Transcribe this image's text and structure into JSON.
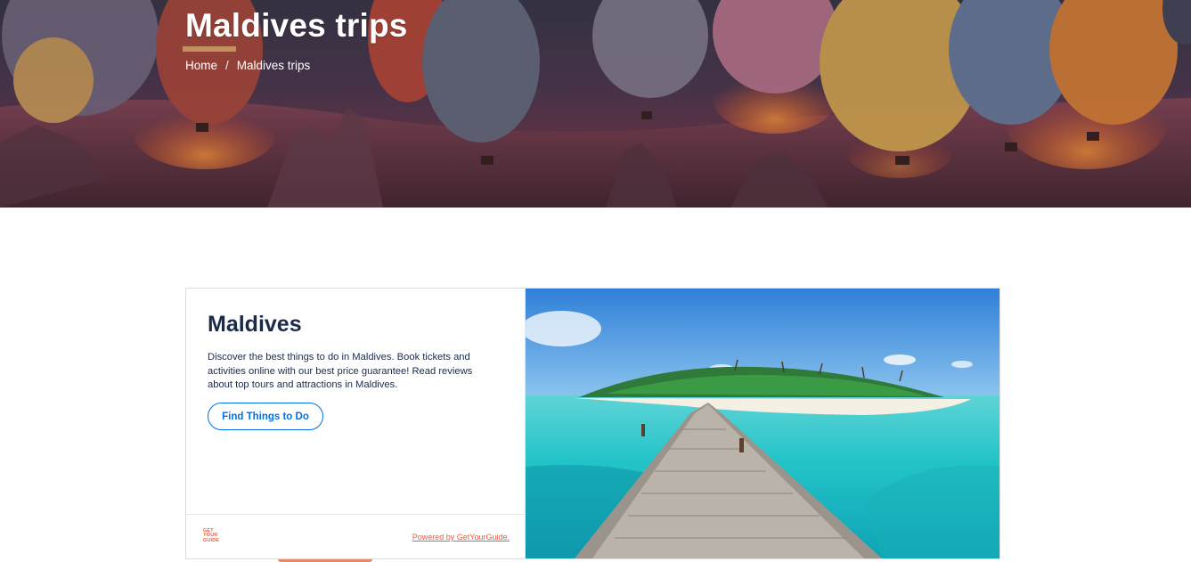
{
  "hero": {
    "title": "Maldives trips",
    "breadcrumb": {
      "home": "Home",
      "separator": "/",
      "current": "Maldives trips"
    },
    "image": "hot-air-balloons-at-dusk"
  },
  "widget": {
    "title": "Maldives",
    "description": "Discover the best things to do in Maldives. Book tickets and activities online with our best price guarantee! Read reviews about top tours and attractions in Maldives.",
    "button_label": "Find Things to Do",
    "logo_lines": [
      "GET",
      "YOUR",
      "GUIDE"
    ],
    "powered_by": "Powered by GetYourGuide.",
    "image": "maldives-island-boardwalk",
    "colors": {
      "title": "#1a2b49",
      "button": "#0071eb",
      "brand": "#ff5533"
    }
  }
}
